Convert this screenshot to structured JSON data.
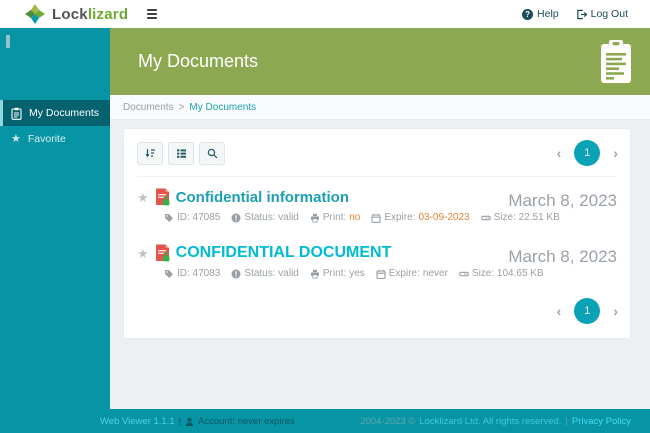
{
  "topbar": {
    "logo_lock": "Lock",
    "logo_lizard": "lizard",
    "help_label": "Help",
    "logout_label": "Log Out"
  },
  "header": {
    "title": "My Documents"
  },
  "breadcrumb": {
    "parent": "Documents",
    "separator": ">",
    "current": "My Documents"
  },
  "sidebar": {
    "items": [
      {
        "label": "My Documents",
        "icon": "clipboard-icon",
        "active": true
      },
      {
        "label": "Favorite",
        "icon": "star-icon",
        "active": false
      }
    ]
  },
  "toolbar": {
    "buttons": [
      "sort",
      "list-view",
      "search"
    ]
  },
  "pagination": {
    "page": "1"
  },
  "documents": [
    {
      "title": "Confidential information",
      "date": "March 8, 2023",
      "meta": {
        "id": "ID: 47085",
        "status": "Status: valid",
        "print_label": "Print:",
        "print_value": "no",
        "expire_label": "Expire:",
        "expire_value": "03-09-2023",
        "size": "Size: 22.51 KB"
      }
    },
    {
      "title": "CONFIDENTIAL DOCUMENT",
      "date": "March 8, 2023",
      "meta": {
        "id": "ID: 47083",
        "status": "Status: valid",
        "print_label": "Print:",
        "print_value": "yes",
        "expire_label": "Expire:",
        "expire_value": "never",
        "size": "Size: 104.65 KB"
      }
    }
  ],
  "footer": {
    "version": "Web Viewer 1.1.1",
    "separator": "|",
    "account": "Account: never expires",
    "copyright": "2004-2023 ©",
    "company": "Locklizard Ltd. All rights reserved.",
    "privacy": "Privacy Policy"
  },
  "icons": {
    "star": "★",
    "chevron_left": "‹",
    "chevron_right": "›",
    "help": "?"
  },
  "colors": {
    "teal": "#0795A6",
    "sidebar_active": "#04616E",
    "header_green": "#8CA952",
    "link_teal": "#19A3B5",
    "title_teal": "#1C9FB4",
    "title_cyan": "#00BCD2",
    "warning_orange": "#E8823C",
    "pager_teal": "#0AA3B6"
  }
}
